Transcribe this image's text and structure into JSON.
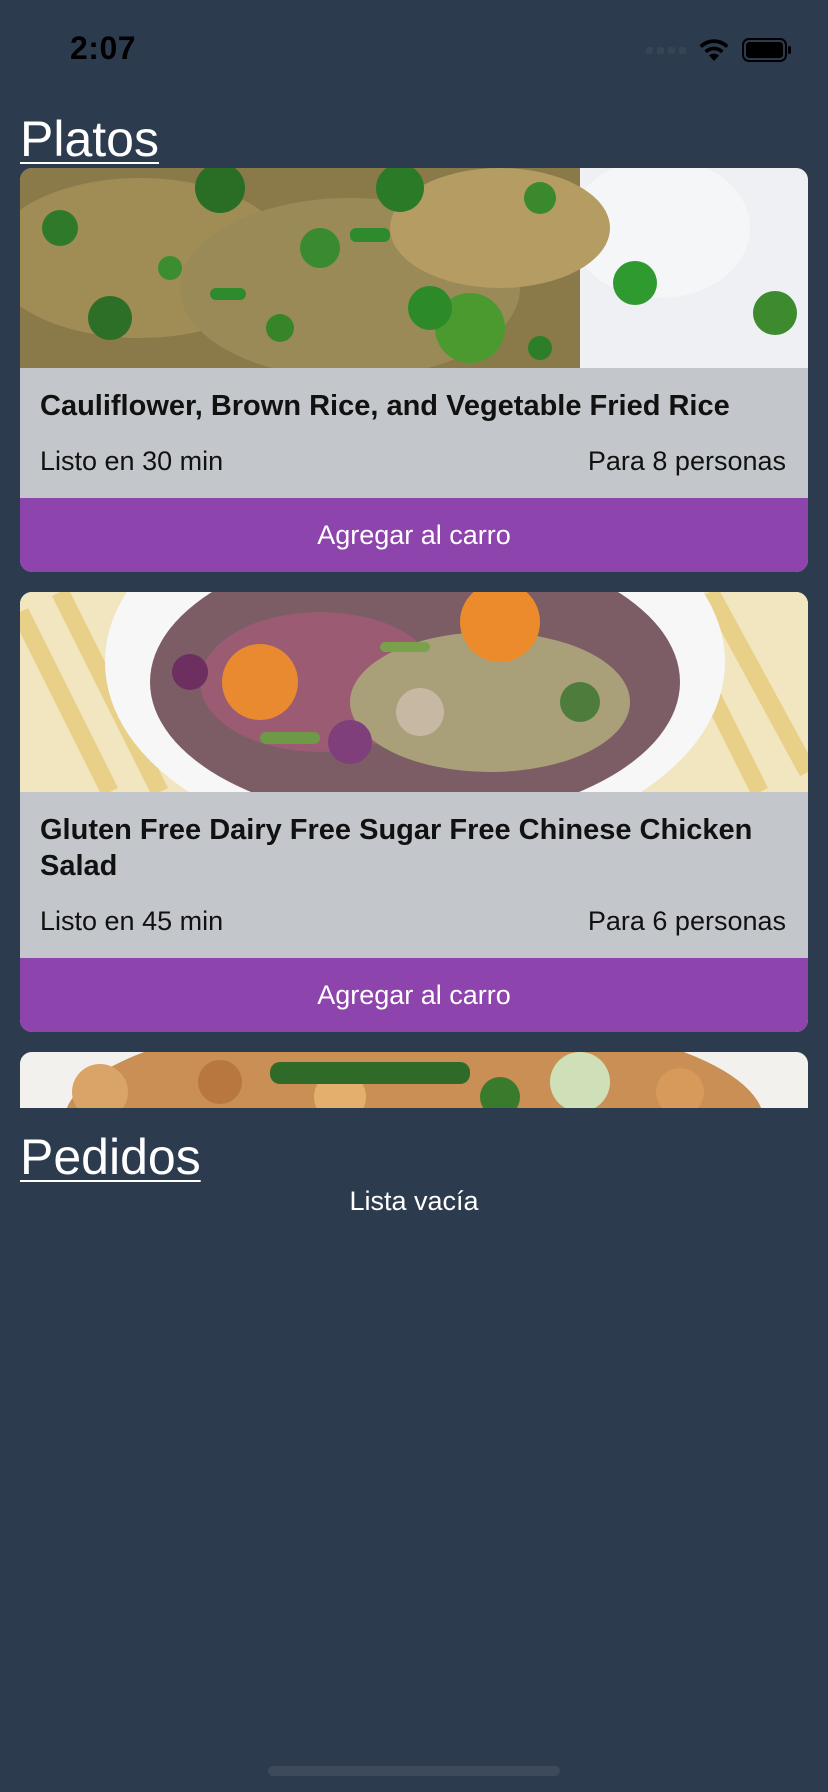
{
  "status_bar": {
    "time": "2:07",
    "icons": [
      "signal-icon",
      "wifi-icon",
      "battery-icon"
    ]
  },
  "platos": {
    "title": "Platos",
    "cards": [
      {
        "title": "Cauliflower, Brown Rice, and Vegetable Fried Rice",
        "ready": "Listo en 30 min",
        "servings": "Para 8 personas",
        "button": "Agregar al carro"
      },
      {
        "title": "Gluten Free Dairy Free Sugar Free Chinese Chicken Salad",
        "ready": "Listo en 45 min",
        "servings": "Para 6 personas",
        "button": "Agregar al carro"
      }
    ]
  },
  "pedidos": {
    "title": "Pedidos",
    "empty_text": "Lista vacía"
  },
  "colors": {
    "background": "#2d3b4e",
    "card": "#c3c7cb",
    "button": "#8e44ad"
  }
}
